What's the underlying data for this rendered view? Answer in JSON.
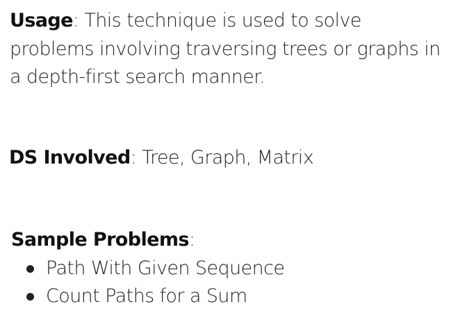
{
  "usage": {
    "label": "Usage",
    "separator": ": ",
    "line1_rest": "This technique is used to solve",
    "line2": "problems involving traversing trees or graphs in",
    "line3": "a depth-first search manner."
  },
  "ds_involved": {
    "label": "DS Involved",
    "separator": ": ",
    "value": "Tree, Graph, Matrix"
  },
  "sample_problems": {
    "label": "Sample Problems",
    "separator": ":",
    "items": [
      "Path With Given Sequence",
      "Count Paths for a Sum"
    ]
  }
}
